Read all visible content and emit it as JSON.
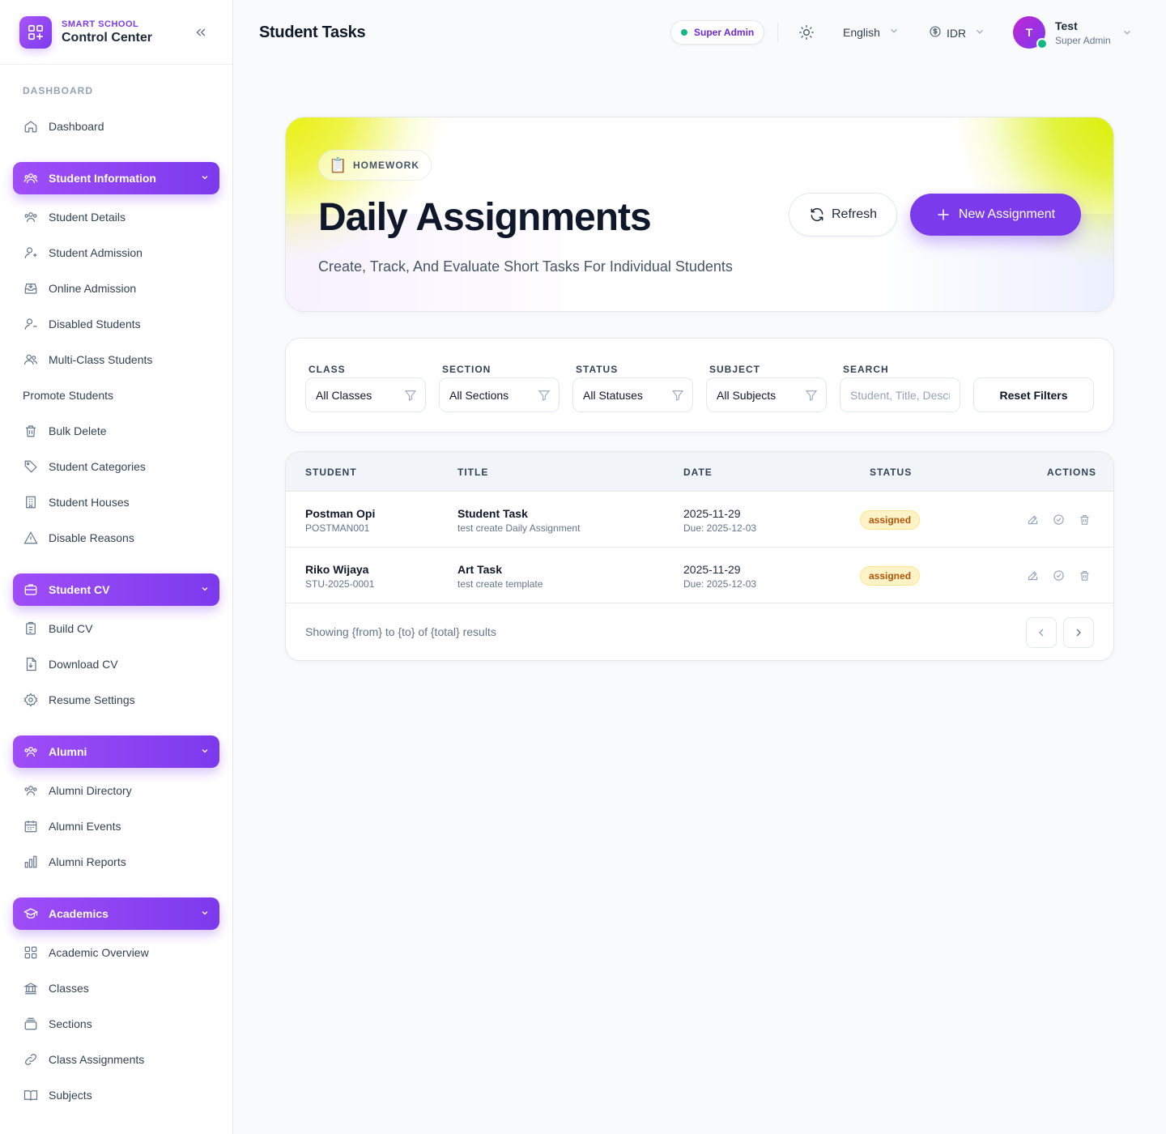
{
  "brand": {
    "sub": "SMART SCHOOL",
    "title": "Control Center"
  },
  "sidebar": {
    "section_dashboard": "DASHBOARD",
    "dashboard": "Dashboard",
    "student_information": "Student Information",
    "student_items": [
      "Student Details",
      "Student Admission",
      "Online Admission",
      "Disabled Students",
      "Multi-Class Students",
      "Promote Students",
      "Bulk Delete",
      "Student Categories",
      "Student Houses",
      "Disable Reasons"
    ],
    "student_cv": "Student CV",
    "cv_items": [
      "Build CV",
      "Download CV",
      "Resume Settings"
    ],
    "alumni": "Alumni",
    "alumni_items": [
      "Alumni Directory",
      "Alumni Events",
      "Alumni Reports"
    ],
    "academics": "Academics",
    "academics_items": [
      "Academic Overview",
      "Classes",
      "Sections",
      "Class Assignments",
      "Subjects"
    ]
  },
  "header": {
    "title": "Student Tasks",
    "role_badge": "Super Admin",
    "language": "English",
    "currency": "IDR",
    "user_initial": "T",
    "user_name": "Test",
    "user_role": "Super Admin"
  },
  "hero": {
    "tag": "HOMEWORK",
    "tag_icon": "📋",
    "title": "Daily Assignments",
    "subtitle": "Create, Track, And Evaluate Short Tasks For Individual Students",
    "refresh_label": "Refresh",
    "new_label": "New Assignment"
  },
  "filters": {
    "class_label": "CLASS",
    "class_value": "All Classes",
    "section_label": "SECTION",
    "section_value": "All Sections",
    "status_label": "STATUS",
    "status_value": "All Statuses",
    "subject_label": "SUBJECT",
    "subject_value": "All Subjects",
    "search_label": "SEARCH",
    "search_placeholder": "Student, Title, Description",
    "reset_label": "Reset Filters"
  },
  "table": {
    "columns": [
      "STUDENT",
      "TITLE",
      "DATE",
      "STATUS",
      "ACTIONS"
    ],
    "rows": [
      {
        "student": "Postman Opi",
        "student_id": "POSTMAN001",
        "title": "Student Task",
        "description": "test create Daily Assignment",
        "date": "2025-11-29",
        "due": "Due: 2025-12-03",
        "status": "assigned"
      },
      {
        "student": "Riko Wijaya",
        "student_id": "STU-2025-0001",
        "title": "Art Task",
        "description": "test create template",
        "date": "2025-11-29",
        "due": "Due: 2025-12-03",
        "status": "assigned"
      }
    ],
    "footer": "Showing {from} to {to} of {total} results"
  },
  "colors": {
    "accent": "#7c3aed",
    "success": "#10b981",
    "badge_bg": "#fef3c7",
    "badge_text": "#b45309"
  }
}
